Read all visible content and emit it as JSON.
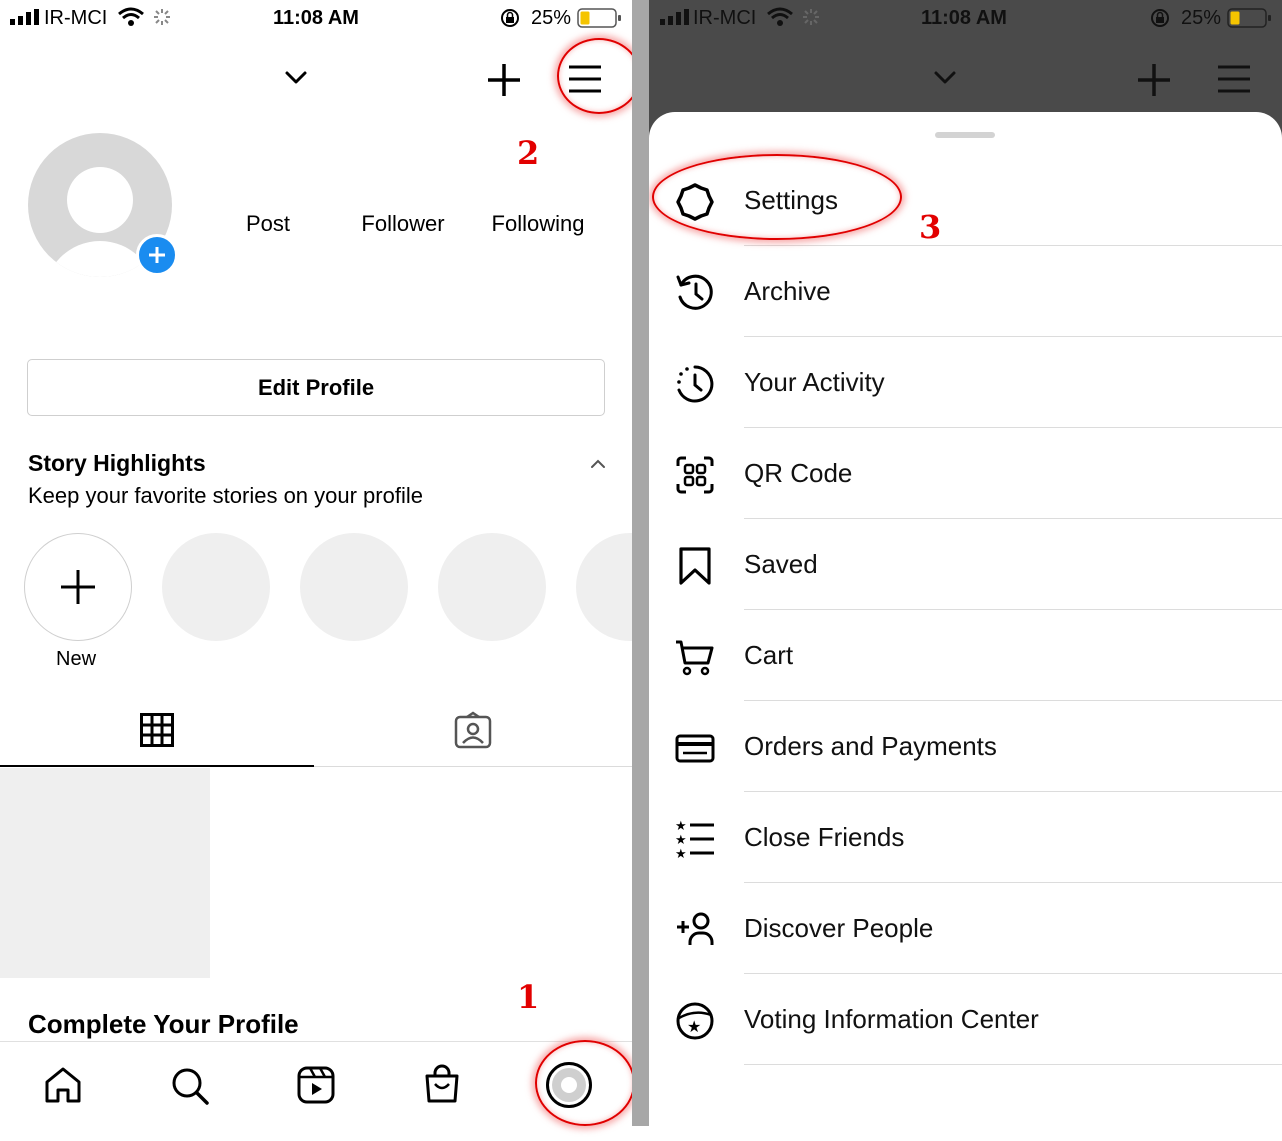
{
  "status_bar": {
    "carrier": "IR-MCI",
    "time": "11:08 AM",
    "battery": "25%"
  },
  "profile": {
    "stats": [
      {
        "label": "Post"
      },
      {
        "label": "Follower"
      },
      {
        "label": "Following"
      }
    ],
    "edit_profile_label": "Edit Profile"
  },
  "highlights": {
    "title": "Story Highlights",
    "subtitle": "Keep your favorite stories on your profile",
    "new_label": "New"
  },
  "complete_profile": {
    "title": "Complete Your Profile"
  },
  "callouts": {
    "one": "1",
    "two": "2",
    "three": "3"
  },
  "menu": {
    "items": [
      {
        "label": "Settings",
        "icon": "settings-icon"
      },
      {
        "label": "Archive",
        "icon": "archive-icon"
      },
      {
        "label": "Your Activity",
        "icon": "activity-icon"
      },
      {
        "label": "QR Code",
        "icon": "qr-code-icon"
      },
      {
        "label": "Saved",
        "icon": "bookmark-icon"
      },
      {
        "label": "Cart",
        "icon": "cart-icon"
      },
      {
        "label": "Orders and Payments",
        "icon": "card-icon"
      },
      {
        "label": "Close Friends",
        "icon": "close-friends-icon"
      },
      {
        "label": "Discover People",
        "icon": "add-person-icon"
      },
      {
        "label": "Voting Information Center",
        "icon": "voting-icon"
      }
    ]
  },
  "colors": {
    "accent_blue": "#1a8cf0",
    "callout_red": "#e20000",
    "dim_overlay": "#4a4a4a",
    "battery_yellow": "#f5c400"
  }
}
